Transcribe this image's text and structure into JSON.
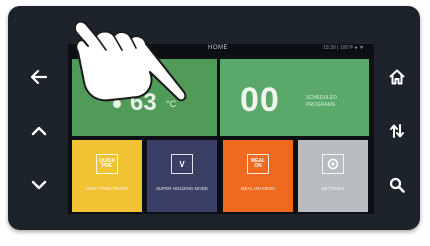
{
  "screen": {
    "title": "HOME",
    "status_info": "15:30  |  100°F  ●  ▼"
  },
  "tiles": {
    "temperature": {
      "value": "63",
      "unit": "°C"
    },
    "programs": {
      "count": "00",
      "label": "SCHEDULED PROGRAMS"
    },
    "t1": {
      "icon_text": "QUICK PRE",
      "label": "LIMIT FOOD READY"
    },
    "t2": {
      "icon_text": "V",
      "label": "SUPER HOLDING MODE"
    },
    "t3": {
      "icon_text": "MEAL ON",
      "label": "MEAL ON MENU"
    },
    "t4": {
      "icon_text": "",
      "label": "SETTINGS"
    }
  },
  "icons": {
    "back": "back-arrow-icon",
    "up": "chevron-up-icon",
    "down": "chevron-down-icon",
    "home": "home-icon",
    "sync": "sync-arrows-icon",
    "search": "search-icon",
    "hand": "pointing-hand-icon"
  },
  "colors": {
    "bezel": "#1d232b",
    "temp_tile": "#4f9b57",
    "programs_tile": "#5aa86a",
    "yellow_tile": "#f1c233",
    "navy_tile": "#3a3f66",
    "orange_tile": "#ef6a1f",
    "gray_tile": "#b8bcc0"
  }
}
